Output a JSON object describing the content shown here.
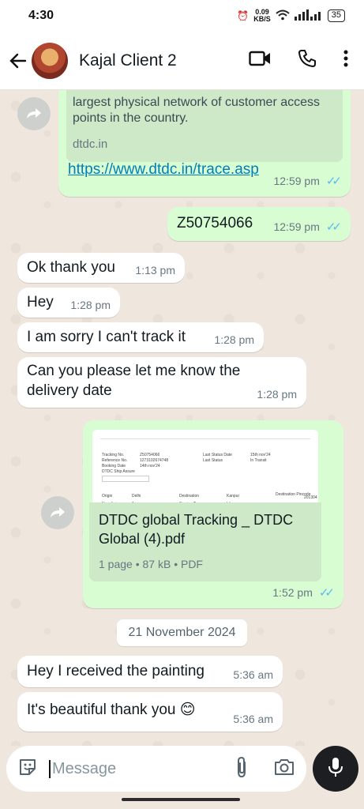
{
  "status_bar": {
    "time": "4:30",
    "speed_value": "0.09",
    "speed_unit": "KB/S",
    "battery": "35"
  },
  "header": {
    "contact_name": "Kajal Client 2"
  },
  "messages": {
    "link": {
      "description": "largest physical network of customer access points in the country.",
      "site": "dtdc.in",
      "url": "https://www.dtdc.in/trace.asp",
      "time": "12:59 pm"
    },
    "tracking": {
      "text": "Z50754066",
      "time": "12:59 pm"
    },
    "m1": {
      "text": "Ok thank you",
      "time": "1:13 pm"
    },
    "m2": {
      "text": "Hey",
      "time": "1:28 pm"
    },
    "m3": {
      "text": "I am sorry I can't track it",
      "time": "1:28 pm"
    },
    "m4": {
      "text": "Can you please let me know the delivery date",
      "time": "1:28 pm"
    },
    "pdf": {
      "name": "DTDC global Tracking _ DTDC Global (4).pdf",
      "meta": "1 page • 87 kB • PDF",
      "time": "1:52 pm",
      "thumb_fields": [
        "Tracking No.",
        "Reference No.",
        "Booking Date",
        "DTDC Ship Assure",
        "Origin",
        "No. of pieces"
      ],
      "thumb_values": [
        "Z50754066",
        "1273102674748",
        "14th nov'24",
        "",
        "Delhi",
        "1"
      ],
      "thumb_fields2": [
        "Last Status Date",
        "Last Status",
        "Destination",
        "Service Type",
        "Destination Pincode"
      ],
      "thumb_values2": [
        "15th nov'24",
        "In Transit",
        "Kanpur",
        "Lite",
        "201304"
      ]
    },
    "date_chip": "21 November 2024",
    "m5": {
      "text": "Hey I received the painting",
      "time": "5:36 am"
    },
    "m6": {
      "text": "It's beautiful thank you 😊",
      "time": "5:36 am"
    }
  },
  "input": {
    "placeholder": "Message"
  }
}
